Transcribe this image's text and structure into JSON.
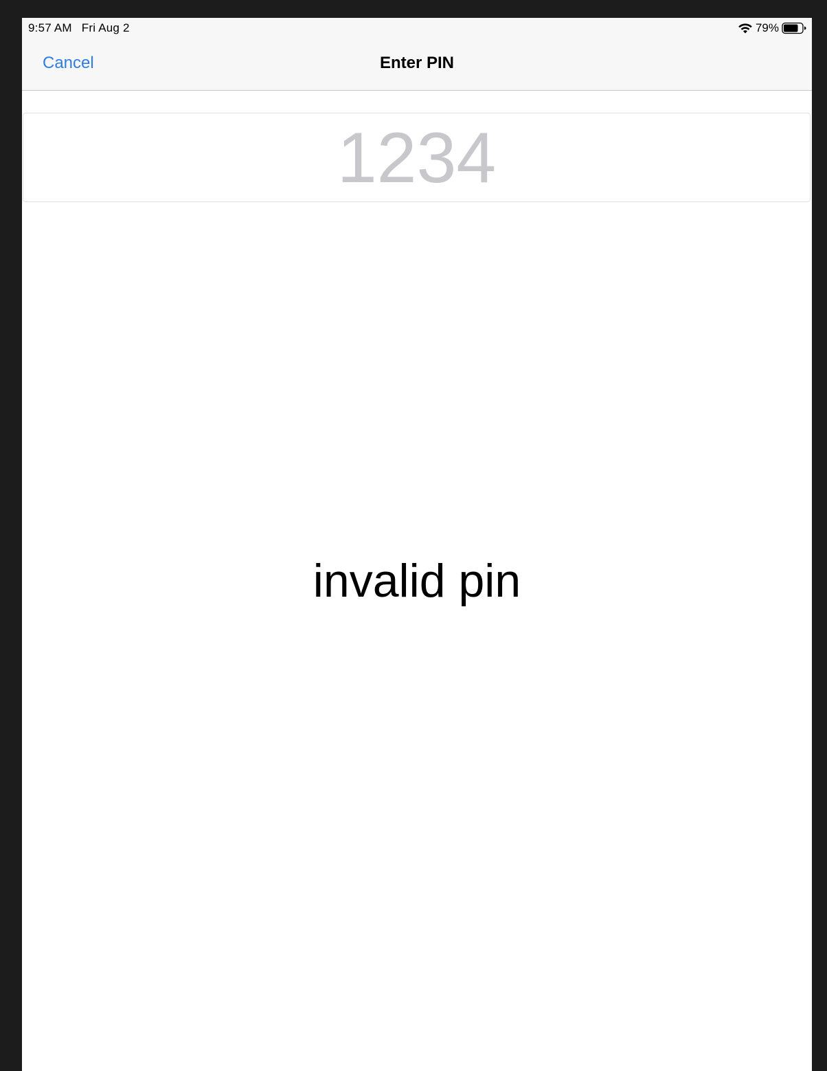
{
  "status_bar": {
    "time": "9:57 AM",
    "date": "Fri Aug 2",
    "battery_percent": "79%",
    "battery_level": 0.79,
    "wifi_icon": "wifi-icon",
    "battery_icon": "battery-icon"
  },
  "nav": {
    "cancel_label": "Cancel",
    "title": "Enter PIN"
  },
  "pin": {
    "placeholder": "1234",
    "value": ""
  },
  "message": "invalid pin",
  "colors": {
    "accent": "#2f7de1",
    "placeholder": "#c7c7cc",
    "bar_background": "#f7f7f7"
  }
}
